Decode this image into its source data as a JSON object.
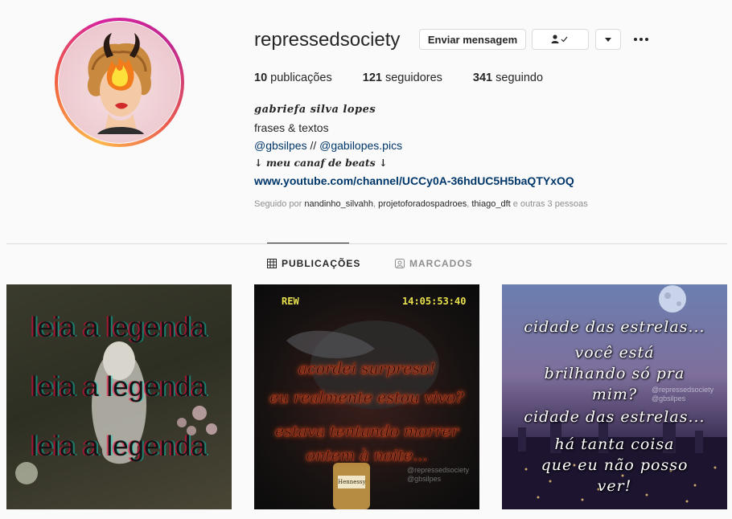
{
  "profile": {
    "username": "repressedsociety",
    "buttons": {
      "message": "Enviar mensagem"
    },
    "stats": {
      "posts_count": "10",
      "posts_label": "publicações",
      "followers_count": "121",
      "followers_label": "seguidores",
      "following_count": "341",
      "following_label": "seguindo"
    },
    "bio": {
      "name": "gabriefa silva lopes",
      "line1": "frases & textos",
      "mention1": "@gbsilpes",
      "separator": " // ",
      "mention2": "@gabilopes.pics",
      "line3": "↓ meu canaf de beats ↓",
      "link": "www.youtube.com/channel/UCCy0A-36hdUC5H5baQTYxOQ"
    },
    "followed_by": {
      "prefix": "Seguido por",
      "users": [
        "nandinho_silvahh",
        "projetoforadospadroes",
        "thiago_dft"
      ],
      "suffix": "e outras 3 pessoas"
    }
  },
  "tabs": [
    {
      "label": "PUBLICAÇÕES",
      "icon": "grid-icon",
      "active": true
    },
    {
      "label": "MARCADOS",
      "icon": "tag-icon",
      "active": false
    }
  ],
  "posts": [
    {
      "lines": [
        "leia a legenda",
        "leia a legenda",
        "leia a legenda"
      ]
    },
    {
      "hud_left": "REW",
      "hud_right": "14:05:53:40",
      "lines": [
        "acordei surpreso!",
        "eu realmente estou vivo?",
        "estava tentando morrer",
        "ontem à noite..."
      ],
      "watermark": [
        "@repressedsociety",
        "@gbsilpes"
      ],
      "bottle_label": "Hennessy"
    },
    {
      "lines": [
        "cidade das estrelas...",
        "você está",
        "brilhando só pra",
        "mim?",
        "cidade das estrelas...",
        "há tanta coisa",
        "que eu não posso",
        "ver!"
      ],
      "watermark": [
        "@repressedsociety",
        "@gbsilpes"
      ]
    }
  ],
  "colors": {
    "link": "#00376b",
    "muted": "#8e8e8e",
    "border": "#dbdbdb",
    "text": "#262626"
  }
}
